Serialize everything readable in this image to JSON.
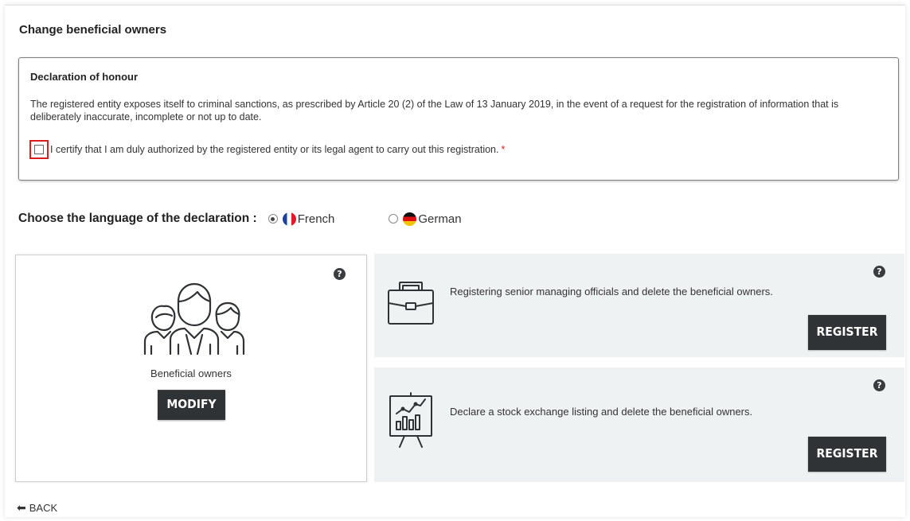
{
  "page": {
    "title": "Change beneficial owners"
  },
  "declaration": {
    "title": "Declaration of honour",
    "text": "The registered entity exposes itself to criminal sanctions, as prescribed by Article 20 (2) of the Law of 13 January 2019, in the event of a request for the registration of information that is deliberately inaccurate, incomplete or not up to date.",
    "certify_label": "I certify that I am duly authorized by the registered entity or its legal agent to carry out this registration.",
    "required_mark": "*",
    "certify_checked": false
  },
  "language": {
    "label": "Choose the language of the declaration :",
    "options": [
      {
        "label": "French",
        "selected": true
      },
      {
        "label": "German",
        "selected": false
      }
    ]
  },
  "cards": {
    "beneficial": {
      "label": "Beneficial owners",
      "button": "MODIFY",
      "icon": "people-group-icon",
      "help": "?"
    },
    "senior_officials": {
      "text": "Registering senior managing officials and delete the beneficial owners.",
      "button": "REGISTER",
      "icon": "briefcase-icon",
      "help": "?"
    },
    "stock_exchange": {
      "text": "Declare a stock exchange listing and delete the beneficial owners.",
      "button": "REGISTER",
      "icon": "presentation-chart-icon",
      "help": "?"
    }
  },
  "navigation": {
    "back_label": "BACK"
  },
  "colors": {
    "accent_red": "#d81e1e",
    "button_dark": "#2f3336",
    "panel_bg": "#eef2f3"
  }
}
